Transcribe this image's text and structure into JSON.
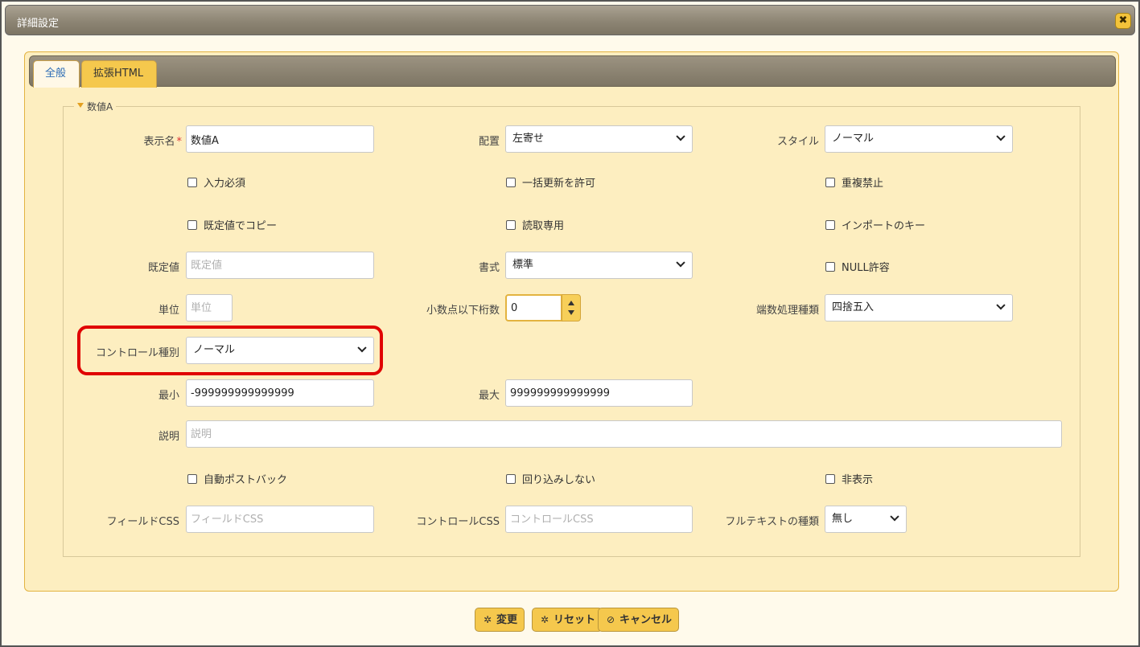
{
  "dialog": {
    "title": "詳細設定",
    "close_glyph": "✖"
  },
  "tabs": [
    {
      "label": "全般",
      "active": true
    },
    {
      "label": "拡張HTML",
      "active": false
    }
  ],
  "section": {
    "title": "数値A"
  },
  "fields": {
    "display_name": {
      "label": "表示名",
      "required_mark": "*",
      "value": "数値A"
    },
    "alignment": {
      "label": "配置",
      "value": "左寄せ"
    },
    "style": {
      "label": "スタイル",
      "value": "ノーマル"
    },
    "default_value": {
      "label": "既定値",
      "placeholder": "既定値"
    },
    "format": {
      "label": "書式",
      "value": "標準"
    },
    "unit": {
      "label": "単位",
      "placeholder": "単位"
    },
    "decimal_places": {
      "label": "小数点以下桁数",
      "value": "0"
    },
    "rounding": {
      "label": "端数処理種類",
      "value": "四捨五入"
    },
    "control_type": {
      "label": "コントロール種別",
      "value": "ノーマル"
    },
    "min": {
      "label": "最小",
      "value": "-999999999999999"
    },
    "max": {
      "label": "最大",
      "value": "999999999999999"
    },
    "description": {
      "label": "説明",
      "placeholder": "説明"
    },
    "field_css": {
      "label": "フィールドCSS",
      "placeholder": "フィールドCSS"
    },
    "control_css": {
      "label": "コントロールCSS",
      "placeholder": "コントロールCSS"
    },
    "fulltext_type": {
      "label": "フルテキストの種類",
      "value": "無し"
    }
  },
  "checkboxes": {
    "required": "入力必須",
    "allow_bulk_update": "一括更新を許可",
    "no_duplicates": "重複禁止",
    "copy_default": "既定値でコピー",
    "read_only": "読取専用",
    "import_key": "インポートのキー",
    "allow_null": "NULL許容",
    "auto_postback": "自動ポストバック",
    "no_wrap": "回り込みしない",
    "hidden": "非表示"
  },
  "buttons": {
    "change": {
      "label": "変更",
      "icon": "gear-icon"
    },
    "reset": {
      "label": "リセット",
      "icon": "gear-icon"
    },
    "cancel": {
      "label": "キャンセル",
      "icon": "ban-icon"
    }
  },
  "colors": {
    "accent": "#f5c84d",
    "highlight": "#e00000",
    "titlebar": "#8d8574"
  }
}
